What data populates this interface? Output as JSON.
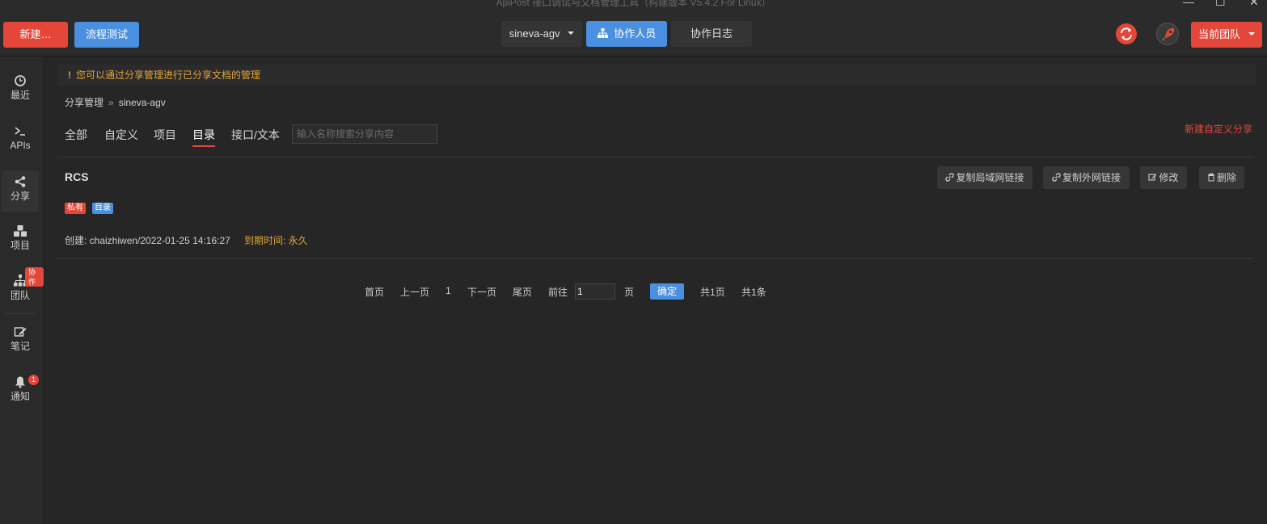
{
  "window": {
    "title": "ApiPost 接口调试与文档管理工具（构建版本 V5.4.2 For Linux）",
    "controls": {
      "minimize": "—",
      "maximize": "☐",
      "close": "✕"
    }
  },
  "topbar": {
    "new_label": "新建…",
    "flow_label": "流程测试",
    "project": "sineva-agv",
    "collab_label": "协作人员",
    "log_label": "协作日志",
    "team_label": "当前团队"
  },
  "sidebar": {
    "items": [
      {
        "label": "最近",
        "icon": "clock-icon"
      },
      {
        "label": "APIs",
        "icon": "terminal-icon"
      },
      {
        "label": "分享",
        "icon": "share-icon"
      },
      {
        "label": "项目",
        "icon": "cubes-icon"
      },
      {
        "label": "团队",
        "icon": "sitemap-icon"
      },
      {
        "label": "笔记",
        "icon": "edit-icon"
      },
      {
        "label": "通知",
        "icon": "bell-icon"
      }
    ],
    "collab_badge": "协作",
    "notification_count": "1"
  },
  "notice": {
    "mark": "!",
    "text": "您可以通过分享管理进行已分享文档的管理"
  },
  "breadcrumb": {
    "root": "分享管理",
    "separator": "»",
    "current": "sineva-agv"
  },
  "filter_tabs": [
    {
      "label": "全部"
    },
    {
      "label": "自定义"
    },
    {
      "label": "项目"
    },
    {
      "label": "目录",
      "active": true
    },
    {
      "label": "接口/文本"
    }
  ],
  "search": {
    "placeholder": "输入名称搜索分享内容",
    "value": ""
  },
  "new_share_label": "新建自定义分享",
  "share_item": {
    "title": "RCS",
    "tags": {
      "private": "私有",
      "type": "目录"
    },
    "created": "创建: chaizhiwen/2022-01-25 14:16:27",
    "expire": "到期时间: 永久",
    "actions": {
      "copy_lan": "复制局域网链接",
      "copy_wan": "复制外网链接",
      "edit": "修改",
      "delete": "删除"
    }
  },
  "pagination": {
    "first": "首页",
    "prev": "上一页",
    "current": "1",
    "next": "下一页",
    "last": "尾页",
    "goto": "前往",
    "goto_value": "1",
    "page_unit": "页",
    "confirm": "确定",
    "total_pages": "共1页",
    "total_items": "共1条"
  },
  "colors": {
    "accent_red": "#e5463a",
    "accent_blue": "#4a8fe0",
    "warning_orange": "#e0a53c",
    "background": "#262626"
  }
}
